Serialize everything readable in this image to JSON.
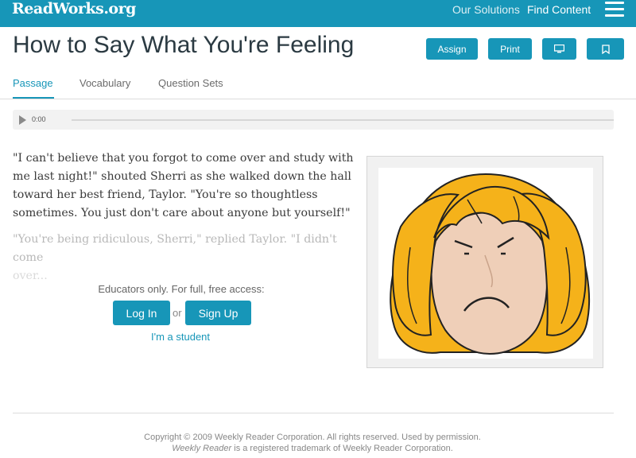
{
  "header": {
    "logo": "ReadWorks",
    "logo_suffix": ".org",
    "nav": [
      "Our Solutions",
      "Find Content"
    ],
    "menu_icon": "hamburger-icon"
  },
  "page": {
    "title": "How to Say What You're Feeling",
    "actions": {
      "assign": "Assign",
      "print": "Print",
      "screen_icon": "monitor-icon",
      "bookmark_icon": "bookmark-icon"
    }
  },
  "tabs": [
    "Passage",
    "Vocabulary",
    "Question Sets"
  ],
  "active_tab": "Passage",
  "audio": {
    "time": "0:00"
  },
  "passage": {
    "paragraph1": "\"I can't believe that you forgot to come over and study with me last night!\" shouted Sherri as she walked down the hall toward her best friend, Taylor. \"You're so thoughtless sometimes. You just don't care about anyone but yourself!\"",
    "paragraph2": "\"You're being ridiculous, Sherri,\" replied Taylor. \"I didn't come",
    "paragraph2_tail": "over..."
  },
  "access": {
    "label": "Educators only. For full, free access:",
    "login": "Log In",
    "or": "or",
    "signup": "Sign Up",
    "student": "I'm a student"
  },
  "footer": {
    "line1": "Copyright © 2009 Weekly Reader Corporation. All rights reserved. Used by permission.",
    "line2_em": "Weekly Reader",
    "line2_rest": " is a registered trademark of Weekly Reader Corporation."
  },
  "colors": {
    "brand": "#1796b8",
    "hair": "#f5b21a",
    "skin": "#efcfb8"
  }
}
